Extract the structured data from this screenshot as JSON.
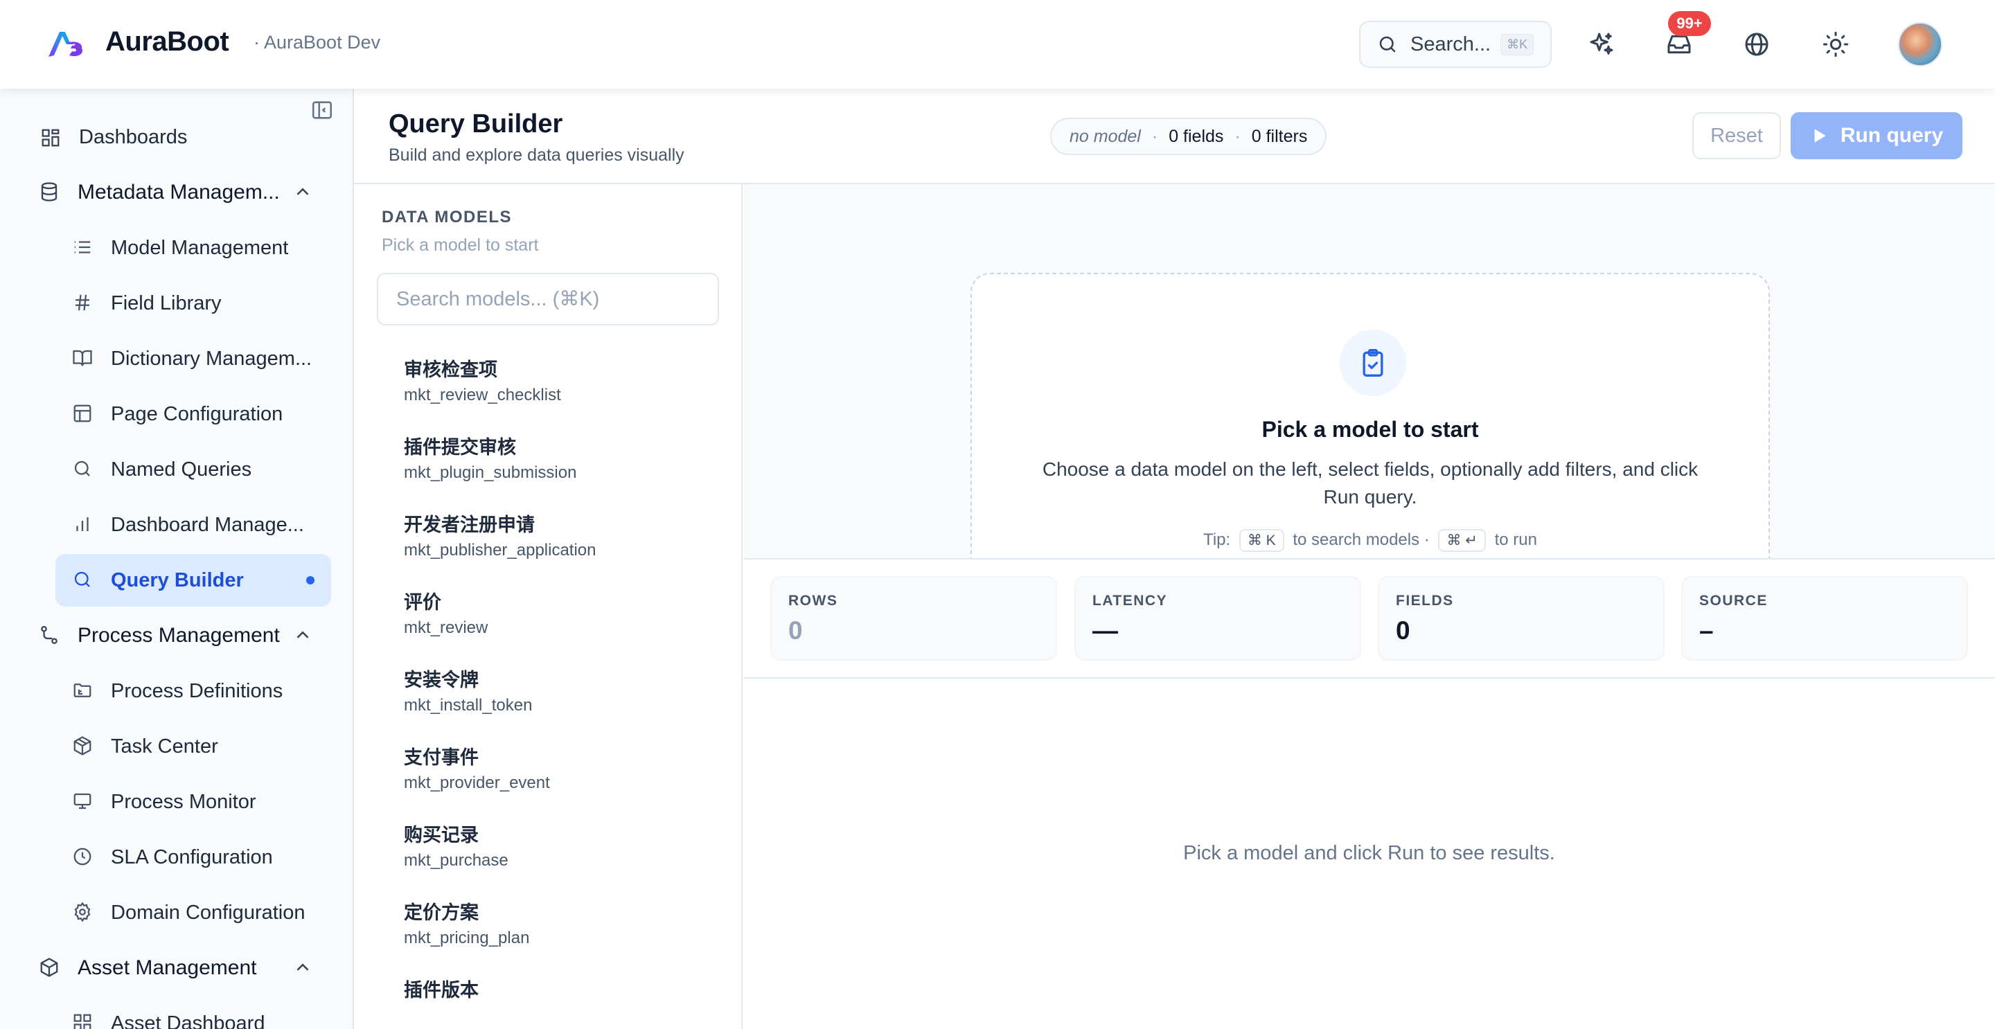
{
  "header": {
    "brand": "AuraBoot",
    "env": "· AuraBoot Dev",
    "search_label": "Search...",
    "search_shortcut": "⌘K",
    "notifications_badge": "99+"
  },
  "sidebar": {
    "items": [
      {
        "label": "Dashboards",
        "icon": "layout-dashboard-icon"
      },
      {
        "label": "Metadata Managem...",
        "icon": "database-icon"
      },
      {
        "label": "Model Management",
        "icon": "list-icon"
      },
      {
        "label": "Field Library",
        "icon": "hash-icon"
      },
      {
        "label": "Dictionary Managem...",
        "icon": "book-open-icon"
      },
      {
        "label": "Page Configuration",
        "icon": "layout-icon"
      },
      {
        "label": "Named Queries",
        "icon": "search-icon"
      },
      {
        "label": "Dashboard Manage...",
        "icon": "bar-chart-icon"
      },
      {
        "label": "Query Builder",
        "icon": "search-icon"
      },
      {
        "label": "Process Management",
        "icon": "workflow-icon"
      },
      {
        "label": "Process Definitions",
        "icon": "folder-tree-icon"
      },
      {
        "label": "Task Center",
        "icon": "package-icon"
      },
      {
        "label": "Process Monitor",
        "icon": "monitor-icon"
      },
      {
        "label": "SLA Configuration",
        "icon": "clock-icon"
      },
      {
        "label": "Domain Configuration",
        "icon": "gear-icon"
      },
      {
        "label": "Asset Management",
        "icon": "box-icon"
      },
      {
        "label": "Asset Dashboard",
        "icon": "layout-grid-icon"
      }
    ]
  },
  "page": {
    "title": "Query Builder",
    "subtitle": "Build and explore data queries visually",
    "status_model": "no model",
    "status_fields": "0 fields",
    "status_filters": "0 filters",
    "reset_label": "Reset",
    "run_label": "Run query"
  },
  "models": {
    "heading": "DATA MODELS",
    "subheading": "Pick a model to start",
    "search_placeholder": "Search models... (⌘K)",
    "items": [
      {
        "name": "审核检查项",
        "code": "mkt_review_checklist"
      },
      {
        "name": "插件提交审核",
        "code": "mkt_plugin_submission"
      },
      {
        "name": "开发者注册申请",
        "code": "mkt_publisher_application"
      },
      {
        "name": "评价",
        "code": "mkt_review"
      },
      {
        "name": "安装令牌",
        "code": "mkt_install_token"
      },
      {
        "name": "支付事件",
        "code": "mkt_provider_event"
      },
      {
        "name": "购买记录",
        "code": "mkt_purchase"
      },
      {
        "name": "定价方案",
        "code": "mkt_pricing_plan"
      },
      {
        "name": "插件版本",
        "code": ""
      }
    ]
  },
  "empty_state": {
    "title": "Pick a model to start",
    "description": "Choose a data model on the left, select fields, optionally add filters, and click Run query.",
    "tip_prefix": "Tip:",
    "tip_key1": "⌘ K",
    "tip_mid": "to search models ·",
    "tip_key2": "⌘ ↵",
    "tip_suffix": "to run"
  },
  "stats": [
    {
      "label": "ROWS",
      "value": "0"
    },
    {
      "label": "LATENCY",
      "value": "—"
    },
    {
      "label": "FIELDS",
      "value": "0"
    },
    {
      "label": "SOURCE",
      "value": "–"
    }
  ],
  "results": {
    "message": "Pick a model and click Run to see results."
  },
  "colors": {
    "accent": "#2563eb",
    "active_bg": "#dbeafe",
    "badge": "#ef4444",
    "run_disabled": "#93b4f8"
  }
}
